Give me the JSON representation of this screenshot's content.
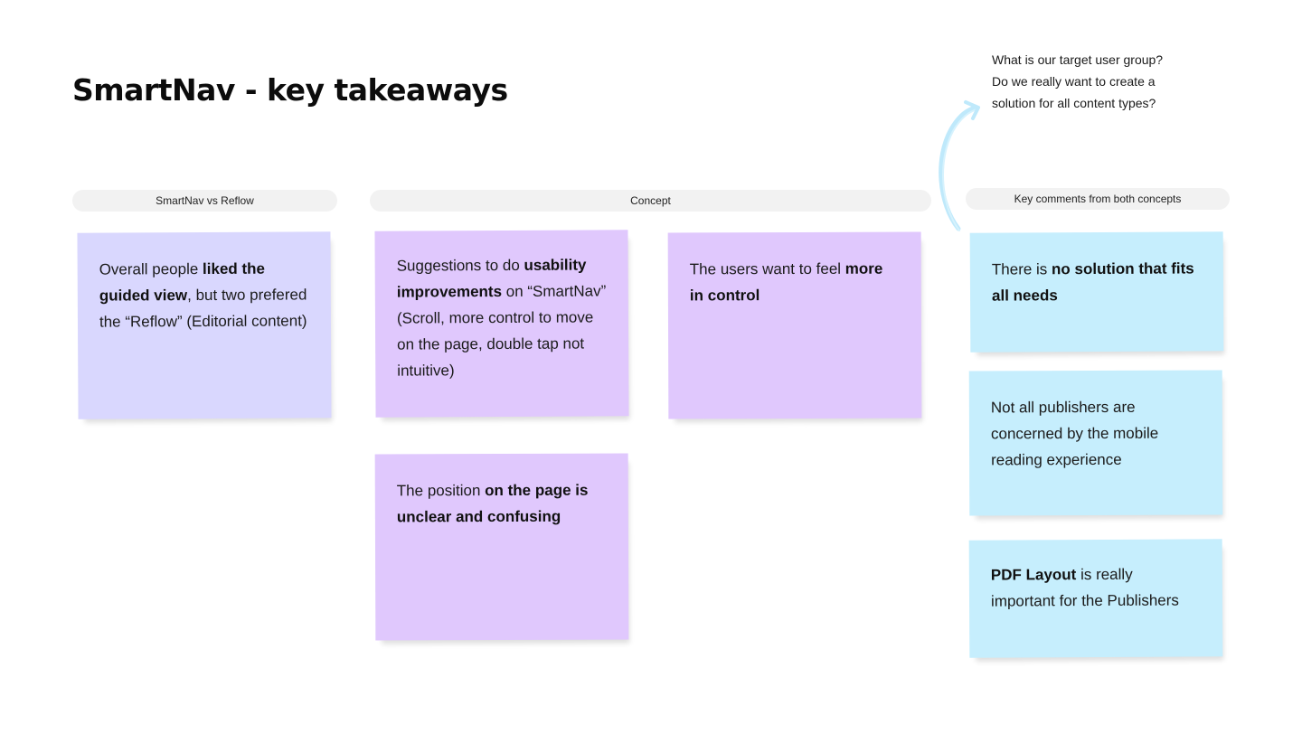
{
  "board": {
    "title": "SmartNav - key takeaways",
    "question": {
      "lines": [
        "What is our target user group?",
        "Do we really want to create a",
        "solution for all content types?"
      ]
    }
  },
  "colors": {
    "lavender": "#d9d7fe",
    "purple": "#e0c8fd",
    "cyan": "#c6eefd",
    "section_label_bg": "#f2f2f2",
    "arrow": "#bfe9fb"
  },
  "sections": [
    {
      "label": "SmartNav vs Reflow"
    },
    {
      "label": "Concept"
    },
    {
      "label": "Key comments from both concepts"
    }
  ],
  "stickies": {
    "s1": {
      "color": "lavender",
      "p1": "Overall people ",
      "b1": "liked the guided view",
      "p2": ", but two prefered the “Reflow” (Editorial content)"
    },
    "s2": {
      "color": "purple",
      "p1": "Suggestions to do ",
      "b1": "usability improvements",
      "p2": " on “SmartNav” (Scroll, more control to move on the page, double tap not intuitive)"
    },
    "s3": {
      "color": "purple",
      "p1": "The users want to feel ",
      "b1": "more in control"
    },
    "s4": {
      "color": "purple",
      "p1": "The position ",
      "b1": "on the page is unclear and confusing"
    },
    "s5": {
      "color": "cyan",
      "p1": "There is ",
      "b1": "no solution that fits all needs"
    },
    "s6": {
      "color": "cyan",
      "p1": "Not all publishers are concerned by the mobile reading experience"
    },
    "s7": {
      "color": "cyan",
      "b1": "PDF Layout",
      "p2": " is really important for the Publishers"
    }
  }
}
